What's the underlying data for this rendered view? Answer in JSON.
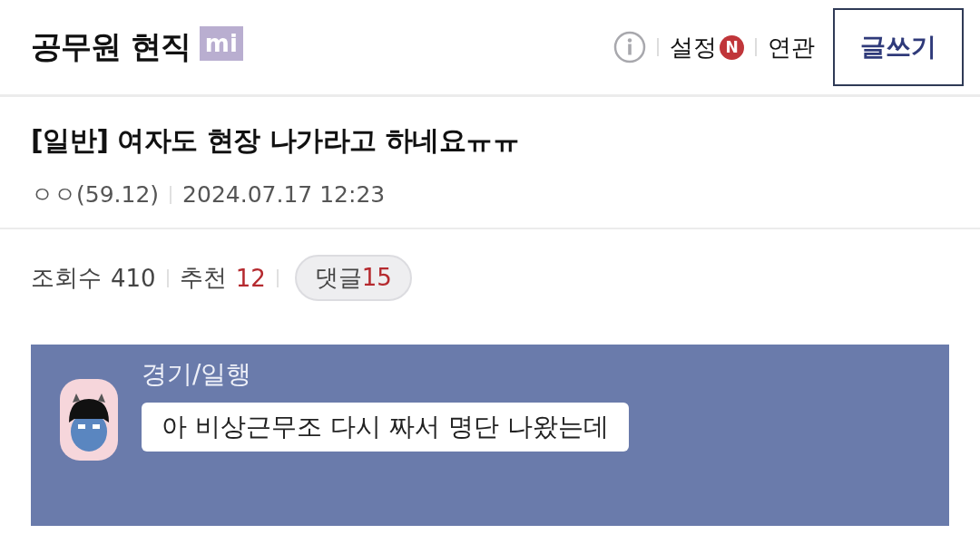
{
  "header": {
    "title": "공무원 현직",
    "badge": "mi",
    "nav": [
      {
        "label": "설정",
        "new_badge": "N"
      },
      {
        "label": "연관"
      }
    ],
    "write_button": "글쓰기"
  },
  "post": {
    "title": "[일반] 여자도 현장 나가라고 하네요ㅠㅠ",
    "author": "ㅇㅇ(59.12)",
    "date": "2024.07.17 12:23",
    "stats": {
      "views_label": "조회수",
      "views": "410",
      "likes_label": "추천",
      "likes": "12",
      "comments_label": "댓글",
      "comments": "15"
    }
  },
  "chat_image": {
    "sender": "경기/일행",
    "message": "아 비상근무조 다시 짜서 명단 나왔는데"
  }
}
